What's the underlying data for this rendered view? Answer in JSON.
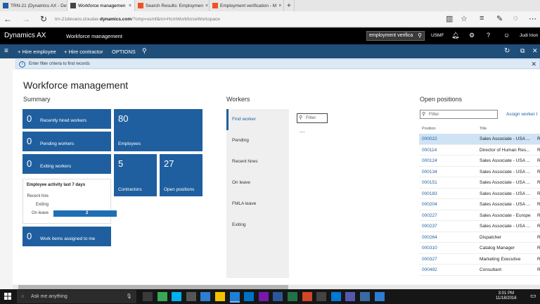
{
  "browser": {
    "tabs": [
      {
        "title": "TRN-21 (Dynamics AX - Dev",
        "color": "#1f5f9f"
      },
      {
        "title": "Workforce managemen",
        "color": "#444444"
      },
      {
        "title": "Search Results: Employmen",
        "color": "#f25022"
      },
      {
        "title": "Employment verification - M",
        "color": "#f25022"
      }
    ],
    "url_prefix": "trn-21devaos.cloudax.",
    "url_domain": "dynamics.com",
    "url_suffix": "/?cmp=usmf&mi=HcmWorkforceWorkspace"
  },
  "header": {
    "brand": "Dynamics AX",
    "module": "Workforce management",
    "search_value": "employment verifica",
    "company": "USMF",
    "user": "Judi Irion"
  },
  "actions": {
    "hire_employee": "Hire employee",
    "hire_contractor": "Hire contractor",
    "options": "OPTIONS"
  },
  "info": {
    "text": "Enter filter criteria to find records"
  },
  "page": {
    "title": "Workforce management"
  },
  "summary": {
    "heading": "Summary",
    "recently_hired": {
      "count": "0",
      "label": "Recently hired workers"
    },
    "pending": {
      "count": "0",
      "label": "Pending workers"
    },
    "exiting": {
      "count": "0",
      "label": "Exiting workers"
    },
    "employees": {
      "count": "80",
      "label": "Employees"
    },
    "contractors": {
      "count": "5",
      "label": "Contractors"
    },
    "open_positions": {
      "count": "27",
      "label": "Open positions"
    },
    "work_items": {
      "count": "0",
      "label": "Work items assigned to me"
    },
    "activity": {
      "title": "Employee activity last 7 days",
      "labels": [
        "Recent hire",
        "Exiting",
        "On leave"
      ],
      "values": [
        0,
        0,
        2
      ],
      "max": 2,
      "on_leave_value": "2"
    }
  },
  "workers": {
    "heading": "Workers",
    "nav": [
      "Find worker",
      "Pending",
      "Recent hires",
      "On leave",
      "FMLA leave",
      "Exiting"
    ],
    "filter_placeholder": "Filter",
    "more": "..."
  },
  "open_positions": {
    "heading": "Open positions",
    "filter_placeholder": "Filter",
    "assign": "Assign worker t",
    "col_position": "Position",
    "col_title": "Title",
    "rows": [
      {
        "position": "000022",
        "title": "Sales Associate - USA ...",
        "r": "R"
      },
      {
        "position": "000114",
        "title": "Director of Human Res...",
        "r": "R"
      },
      {
        "position": "000124",
        "title": "Sales Associate - USA ...",
        "r": "R"
      },
      {
        "position": "000134",
        "title": "Sales Associate - USA ...",
        "r": "R"
      },
      {
        "position": "000151",
        "title": "Sales Associate - USA ...",
        "r": "R"
      },
      {
        "position": "000183",
        "title": "Sales Associate - USA ...",
        "r": "R"
      },
      {
        "position": "000204",
        "title": "Sales Associate - USA ...",
        "r": "R"
      },
      {
        "position": "000227",
        "title": "Sales Associate - Europe",
        "r": "R"
      },
      {
        "position": "000237",
        "title": "Sales Associate - USA ...",
        "r": "R"
      },
      {
        "position": "000264",
        "title": "Dispatcher",
        "r": "R"
      },
      {
        "position": "000310",
        "title": "Catalog Manager",
        "r": "R"
      },
      {
        "position": "000327",
        "title": "Marketing Executive",
        "r": "R"
      },
      {
        "position": "000492",
        "title": "Consultant",
        "r": "R"
      }
    ]
  },
  "taskbar": {
    "search": "Ask me anything",
    "time": "3:01 PM",
    "date": "11/18/2016"
  }
}
